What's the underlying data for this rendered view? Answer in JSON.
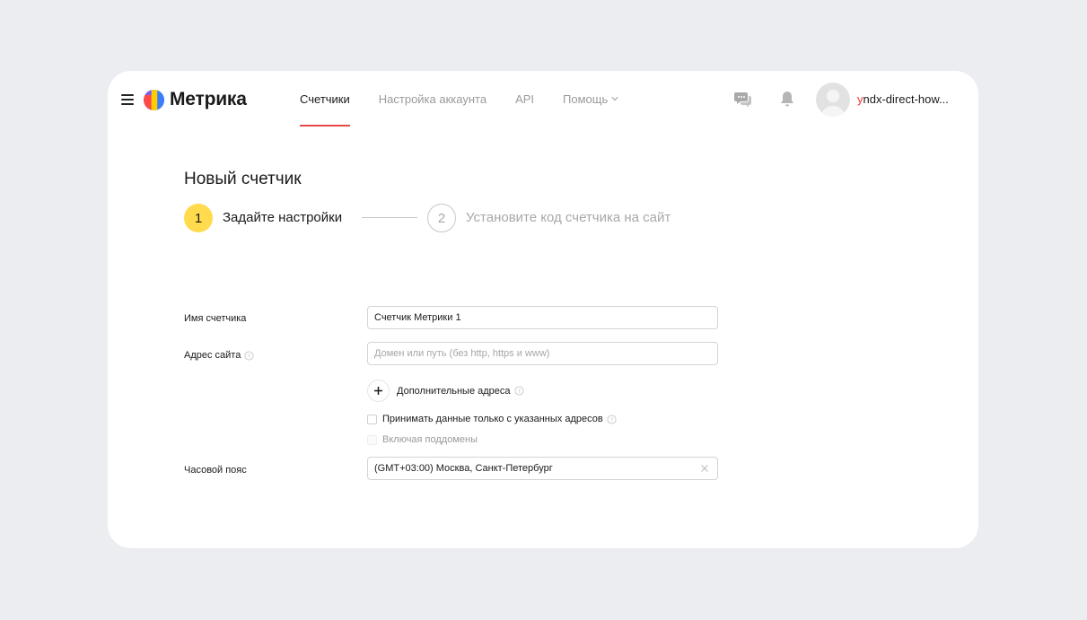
{
  "header": {
    "logo_text": "Метрика",
    "nav": [
      {
        "label": "Счетчики"
      },
      {
        "label": "Настройка аккаунта"
      },
      {
        "label": "API"
      },
      {
        "label": "Помощь"
      }
    ],
    "username_first": "y",
    "username_rest": "ndx-direct-how..."
  },
  "page": {
    "title": "Новый счетчик"
  },
  "stepper": {
    "steps": [
      {
        "number": "1",
        "label": "Задайте настройки"
      },
      {
        "number": "2",
        "label": "Установите код счетчика на сайт"
      }
    ]
  },
  "form": {
    "name_label": "Имя счетчика",
    "name_value": "Счетчик Метрики 1",
    "address_label": "Адрес сайта",
    "address_placeholder": "Домен или путь (без http, https и www)",
    "extra_addresses_label": "Дополнительные адреса",
    "only_listed_label": "Принимать данные только с указанных адресов",
    "subdomains_label": "Включая поддомены",
    "timezone_label": "Часовой пояс",
    "timezone_value": "(GMT+03:00) Москва, Санкт-Петербург"
  },
  "colors": {
    "background": "#ebedf1",
    "card": "#ffffff",
    "active_tab_underline": "#e84a4a",
    "step_active": "#ffdb4d",
    "username_accent": "#ff3333"
  },
  "icons": {
    "menu": "menu-icon",
    "logo": "metrika-logo-icon",
    "help_chevron": "chevron-down-icon",
    "chat": "chat-icon",
    "bell": "bell-icon",
    "avatar": "avatar",
    "help": "help-icon",
    "plus": "plus-icon",
    "clear": "clear-icon"
  }
}
